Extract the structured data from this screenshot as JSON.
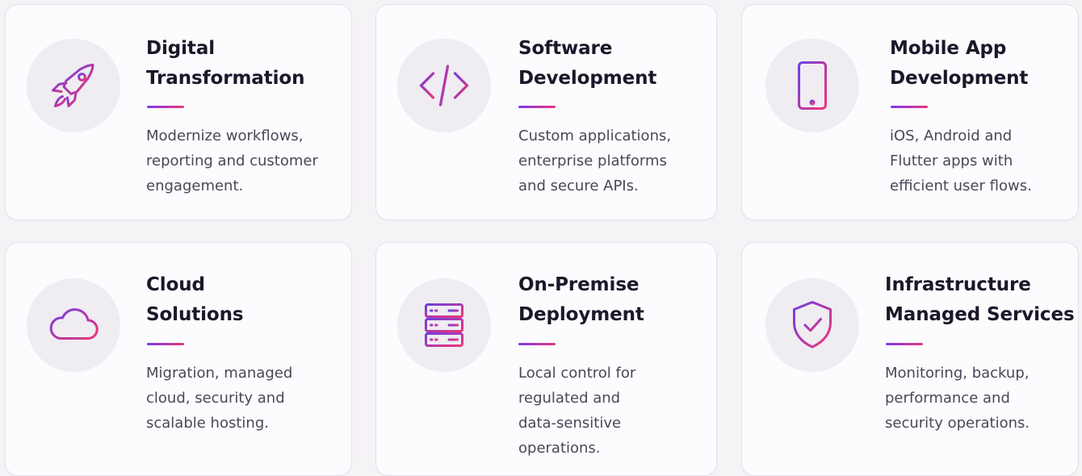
{
  "accent": {
    "from": "#7c3aed",
    "to": "#e8357a"
  },
  "cards": [
    {
      "icon": "rocket-icon",
      "title_lines": [
        "Digital",
        "Transformation"
      ],
      "desc_lines": [
        "Modernize workflows,",
        "reporting and customer",
        "engagement."
      ]
    },
    {
      "icon": "code-icon",
      "title_lines": [
        "Software",
        "Development"
      ],
      "desc_lines": [
        "Custom applications,",
        "enterprise platforms",
        "and secure APIs."
      ]
    },
    {
      "icon": "smartphone-icon",
      "title_lines": [
        "Mobile App",
        "Development"
      ],
      "desc_lines": [
        "iOS, Android and",
        "Flutter apps with",
        "efficient user flows."
      ]
    },
    {
      "icon": "cloud-icon",
      "title_lines": [
        "Cloud",
        "Solutions"
      ],
      "desc_lines": [
        "Migration, managed",
        "cloud, security and",
        "scalable hosting."
      ]
    },
    {
      "icon": "server-icon",
      "title_lines": [
        "On-Premise",
        "Deployment"
      ],
      "desc_lines": [
        "Local control for",
        "regulated and",
        "data-sensitive",
        "operations."
      ]
    },
    {
      "icon": "shield-check-icon",
      "title_lines": [
        "Infrastructure",
        "Managed Services"
      ],
      "desc_lines": [
        "Monitoring, backup,",
        "performance and",
        "security operations."
      ]
    }
  ]
}
